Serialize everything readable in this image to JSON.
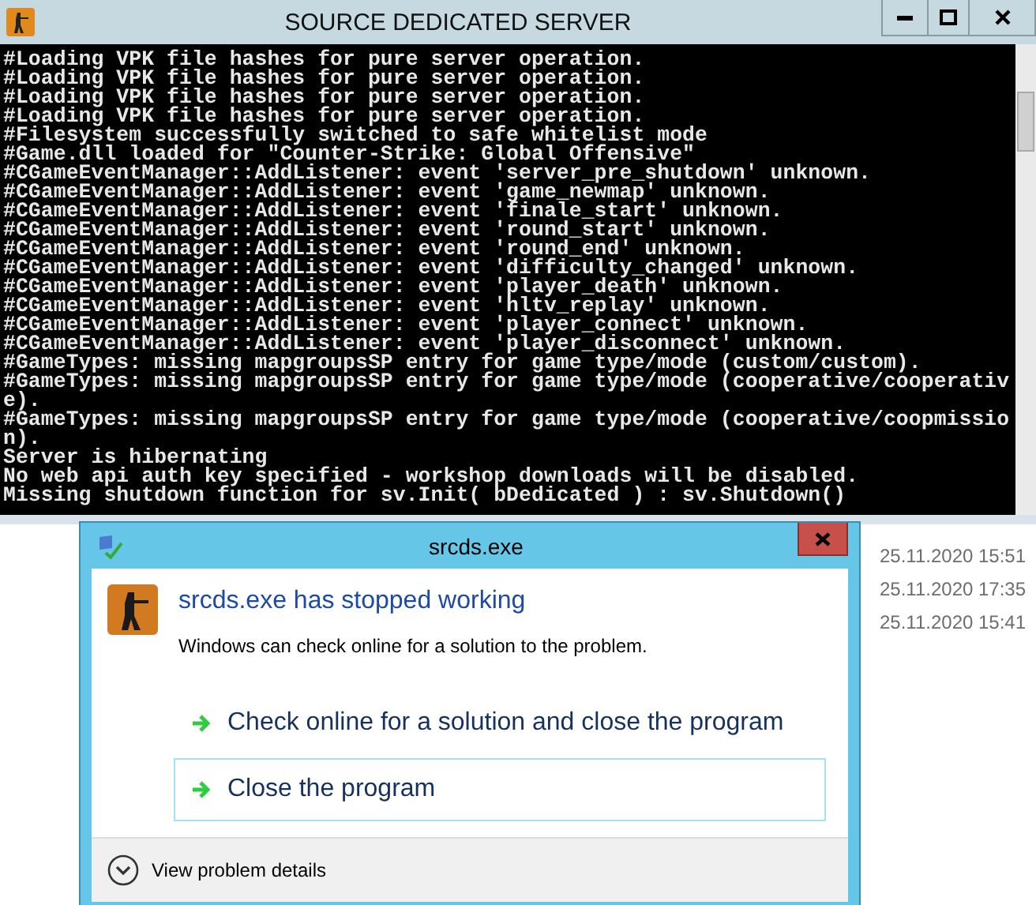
{
  "console_window": {
    "title": "SOURCE DEDICATED SERVER",
    "lines": [
      "#Loading VPK file hashes for pure server operation.",
      "#Loading VPK file hashes for pure server operation.",
      "#Loading VPK file hashes for pure server operation.",
      "#Loading VPK file hashes for pure server operation.",
      "#Filesystem successfully switched to safe whitelist mode",
      "#Game.dll loaded for \"Counter-Strike: Global Offensive\"",
      "#CGameEventManager::AddListener: event 'server_pre_shutdown' unknown.",
      "#CGameEventManager::AddListener: event 'game_newmap' unknown.",
      "#CGameEventManager::AddListener: event 'finale_start' unknown.",
      "#CGameEventManager::AddListener: event 'round_start' unknown.",
      "#CGameEventManager::AddListener: event 'round_end' unknown.",
      "#CGameEventManager::AddListener: event 'difficulty_changed' unknown.",
      "#CGameEventManager::AddListener: event 'player_death' unknown.",
      "#CGameEventManager::AddListener: event 'hltv_replay' unknown.",
      "#CGameEventManager::AddListener: event 'player_connect' unknown.",
      "#CGameEventManager::AddListener: event 'player_disconnect' unknown.",
      "#GameTypes: missing mapgroupsSP entry for game type/mode (custom/custom).",
      "#GameTypes: missing mapgroupsSP entry for game type/mode (cooperative/cooperativ",
      "e).",
      "#GameTypes: missing mapgroupsSP entry for game type/mode (cooperative/coopmissio",
      "n).",
      "Server is hibernating",
      "No web api auth key specified - workshop downloads will be disabled.",
      "Missing shutdown function for sv.Init( bDedicated ) : sv.Shutdown()"
    ]
  },
  "file_dates": [
    "25.11.2020 15:51",
    "25.11.2020 17:35",
    "25.11.2020 15:41"
  ],
  "error_dialog": {
    "title": "srcds.exe",
    "heading": "srcds.exe has stopped working",
    "description": "Windows can check online for a solution to the problem.",
    "options": [
      {
        "label": "Check online for a solution and close the program",
        "selected": false
      },
      {
        "label": "Close the program",
        "selected": true
      }
    ],
    "details_toggle": {
      "label": "View problem details",
      "expanded": false
    }
  }
}
